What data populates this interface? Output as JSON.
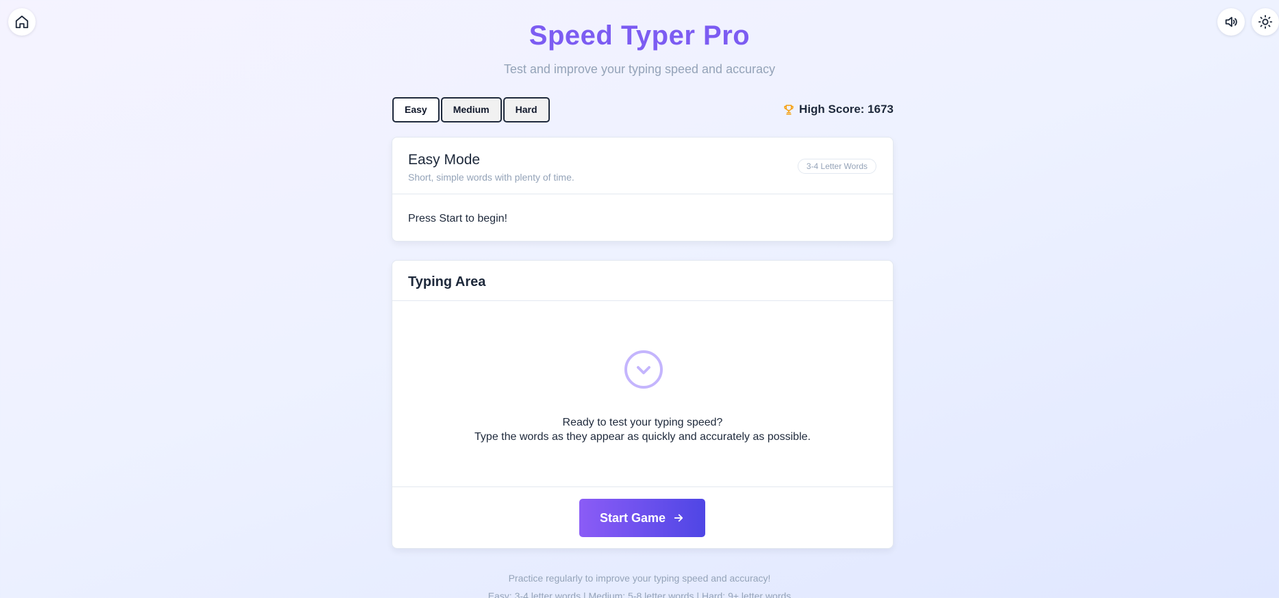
{
  "header": {
    "title": "Speed Typer Pro",
    "subtitle": "Test and improve your typing speed and accuracy"
  },
  "corner_buttons": {
    "home_icon": "home-icon",
    "sound_icon": "volume-icon",
    "theme_icon": "sun-icon"
  },
  "difficulty": {
    "options": [
      "Easy",
      "Medium",
      "Hard"
    ],
    "selected": "Easy"
  },
  "high_score": {
    "label": "High Score: 1673",
    "icon": "trophy-icon",
    "icon_color": "#f59e0b"
  },
  "mode_card": {
    "title": "Easy Mode",
    "description": "Short, simple words with plenty of time.",
    "badge": "3-4 Letter Words",
    "prompt": "Press Start to begin!"
  },
  "typing_card": {
    "title": "Typing Area",
    "ready_icon": "chevron-down-circle-icon",
    "ready_line_1": "Ready to test your typing speed?",
    "ready_line_2": "Type the words as they appear as quickly and accurately as possible.",
    "start_label": "Start Game",
    "start_icon": "arrow-right-icon"
  },
  "footer": {
    "line_1": "Practice regularly to improve your typing speed and accuracy!",
    "line_2": "Easy: 3-4 letter words | Medium: 5-8 letter words | Hard: 9+ letter words"
  },
  "colors": {
    "accent": "#7c5cf2",
    "button_gradient_start": "#8b5cf6",
    "button_gradient_end": "#4f46e5",
    "muted_text": "#94a3b8"
  }
}
